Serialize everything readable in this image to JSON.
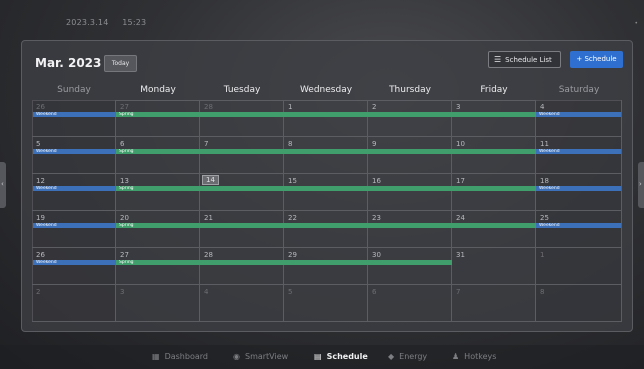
{
  "status": {
    "date": "2023.3.14",
    "time": "15:23"
  },
  "calendar": {
    "month_title": "Mar. 2023",
    "today_label": "Today",
    "schedule_list_label": "Schedule List",
    "add_schedule_label": "+ Schedule",
    "weekdays": [
      "Sunday",
      "Monday",
      "Tuesday",
      "Wednesday",
      "Thursday",
      "Friday",
      "Saturday"
    ],
    "weeks": [
      [
        "26",
        "27",
        "28",
        "1",
        "2",
        "3",
        "4"
      ],
      [
        "5",
        "6",
        "7",
        "8",
        "9",
        "10",
        "11"
      ],
      [
        "12",
        "13",
        "14",
        "15",
        "16",
        "17",
        "18"
      ],
      [
        "19",
        "20",
        "21",
        "22",
        "23",
        "24",
        "25"
      ],
      [
        "26",
        "27",
        "28",
        "29",
        "30",
        "31",
        "1"
      ],
      [
        "2",
        "3",
        "4",
        "5",
        "6",
        "7",
        "8"
      ]
    ],
    "today": {
      "week": 2,
      "day": 2
    },
    "events": {
      "weekend_label": "Weekend",
      "spring_label": "Spring"
    }
  },
  "nav": {
    "items": [
      {
        "label": "Dashboard",
        "icon": "dashboard-icon"
      },
      {
        "label": "SmartView",
        "icon": "smartview-icon"
      },
      {
        "label": "Schedule",
        "icon": "schedule-icon"
      },
      {
        "label": "Energy",
        "icon": "energy-icon"
      },
      {
        "label": "Hotkeys",
        "icon": "hotkeys-icon"
      }
    ],
    "active": "Schedule"
  },
  "colors": {
    "accent": "#2f6fcf",
    "weekend_event": "#3c70b8",
    "spring_event": "#3f9e6b"
  }
}
